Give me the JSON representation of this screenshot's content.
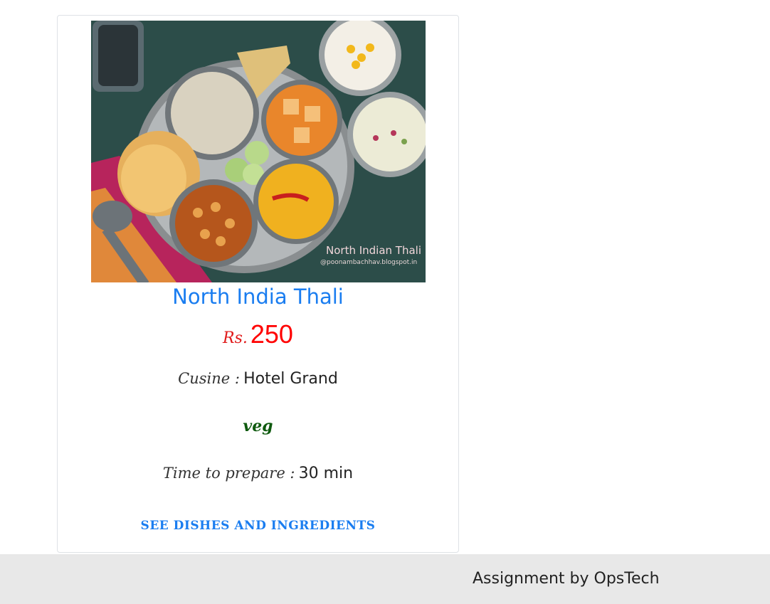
{
  "card": {
    "image_alt": "North India Thali photo",
    "image_caption": "North Indian Thali",
    "image_credit": "@poonambachhav.blogspot.in",
    "title": "North India Thali",
    "price_currency": "Rs.",
    "price_value": "250",
    "cuisine_label": "Cusine :",
    "cuisine_value": "Hotel Grand",
    "diet": "veg",
    "time_label": "Time to prepare :",
    "time_value": "30 min",
    "link_label": "SEE DISHES AND INGREDIENTS"
  },
  "footer": {
    "text": "Assignment by OpsTech"
  },
  "colors": {
    "title": "#1a7df0",
    "price": "#ff0000",
    "diet": "#0f5a0f",
    "link": "#1a7df0",
    "footer_bg": "#e8e8e8"
  }
}
